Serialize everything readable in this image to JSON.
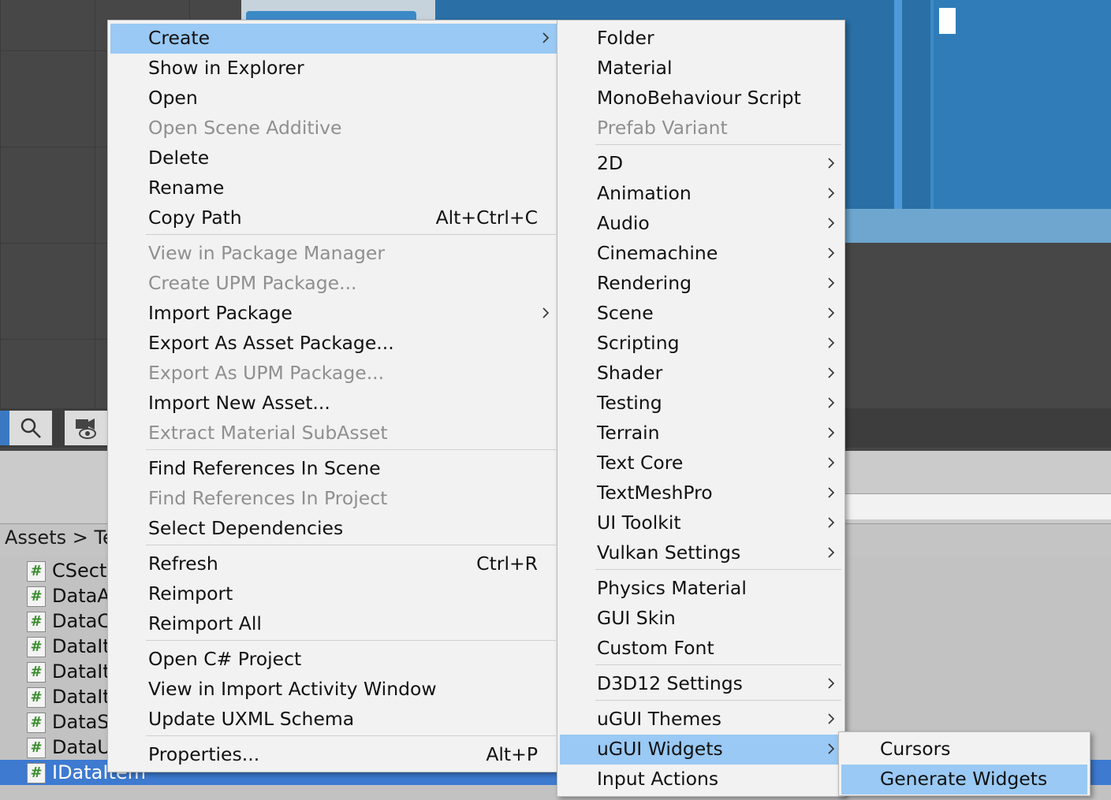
{
  "project": {
    "breadcrumb": "Assets > Te",
    "files": [
      {
        "name": "CSect",
        "icon": "#"
      },
      {
        "name": "DataA",
        "icon": "#"
      },
      {
        "name": "DataC",
        "icon": "#"
      },
      {
        "name": "DataIt",
        "icon": "#"
      },
      {
        "name": "DataIt",
        "icon": "#"
      },
      {
        "name": "DataIt",
        "icon": "#"
      },
      {
        "name": "DataS",
        "icon": "#"
      },
      {
        "name": "DataU",
        "icon": "#"
      },
      {
        "name": "IDataItem",
        "icon": "#",
        "selected": true
      }
    ]
  },
  "context_menu": {
    "items": [
      {
        "label": "Create",
        "submenu": true,
        "highlighted": true
      },
      {
        "label": "Show in Explorer"
      },
      {
        "label": "Open"
      },
      {
        "label": "Open Scene Additive",
        "disabled": true
      },
      {
        "label": "Delete"
      },
      {
        "label": "Rename"
      },
      {
        "label": "Copy Path",
        "shortcut": "Alt+Ctrl+C"
      },
      {
        "label": "View in Package Manager",
        "disabled": true
      },
      {
        "label": "Create UPM Package...",
        "disabled": true
      },
      {
        "label": "Import Package",
        "submenu": true
      },
      {
        "label": "Export As Asset Package..."
      },
      {
        "label": "Export As UPM Package...",
        "disabled": true
      },
      {
        "label": "Import New Asset..."
      },
      {
        "label": "Extract Material SubAsset",
        "disabled": true
      },
      {
        "label": "Find References In Scene"
      },
      {
        "label": "Find References In Project",
        "disabled": true
      },
      {
        "label": "Select Dependencies"
      },
      {
        "label": "Refresh",
        "shortcut": "Ctrl+R"
      },
      {
        "label": "Reimport"
      },
      {
        "label": "Reimport All"
      },
      {
        "label": "Open C# Project"
      },
      {
        "label": "View in Import Activity Window"
      },
      {
        "label": "Update UXML Schema"
      },
      {
        "label": "Properties...",
        "shortcut": "Alt+P"
      }
    ]
  },
  "create_submenu": {
    "items": [
      {
        "label": "Folder"
      },
      {
        "label": "Material"
      },
      {
        "label": "MonoBehaviour Script"
      },
      {
        "label": "Prefab Variant",
        "disabled": true
      },
      {
        "label": "2D",
        "submenu": true
      },
      {
        "label": "Animation",
        "submenu": true
      },
      {
        "label": "Audio",
        "submenu": true
      },
      {
        "label": "Cinemachine",
        "submenu": true
      },
      {
        "label": "Rendering",
        "submenu": true
      },
      {
        "label": "Scene",
        "submenu": true
      },
      {
        "label": "Scripting",
        "submenu": true
      },
      {
        "label": "Shader",
        "submenu": true
      },
      {
        "label": "Testing",
        "submenu": true
      },
      {
        "label": "Terrain",
        "submenu": true
      },
      {
        "label": "Text Core",
        "submenu": true
      },
      {
        "label": "TextMeshPro",
        "submenu": true
      },
      {
        "label": "UI Toolkit",
        "submenu": true
      },
      {
        "label": "Vulkan Settings",
        "submenu": true
      },
      {
        "label": "Physics Material"
      },
      {
        "label": "GUI Skin"
      },
      {
        "label": "Custom Font"
      },
      {
        "label": "D3D12 Settings",
        "submenu": true
      },
      {
        "label": "uGUI Themes",
        "submenu": true
      },
      {
        "label": "uGUI Widgets",
        "submenu": true,
        "highlighted": true
      },
      {
        "label": "Input Actions"
      }
    ]
  },
  "widgets_submenu": {
    "items": [
      {
        "label": "Cursors"
      },
      {
        "label": "Generate Widgets",
        "highlighted": true
      }
    ]
  },
  "colors": {
    "highlight": "#99c9f4",
    "menu_bg": "#f2f2f2",
    "disabled_text": "#8f8f8f",
    "selection": "#3d7ad0"
  }
}
